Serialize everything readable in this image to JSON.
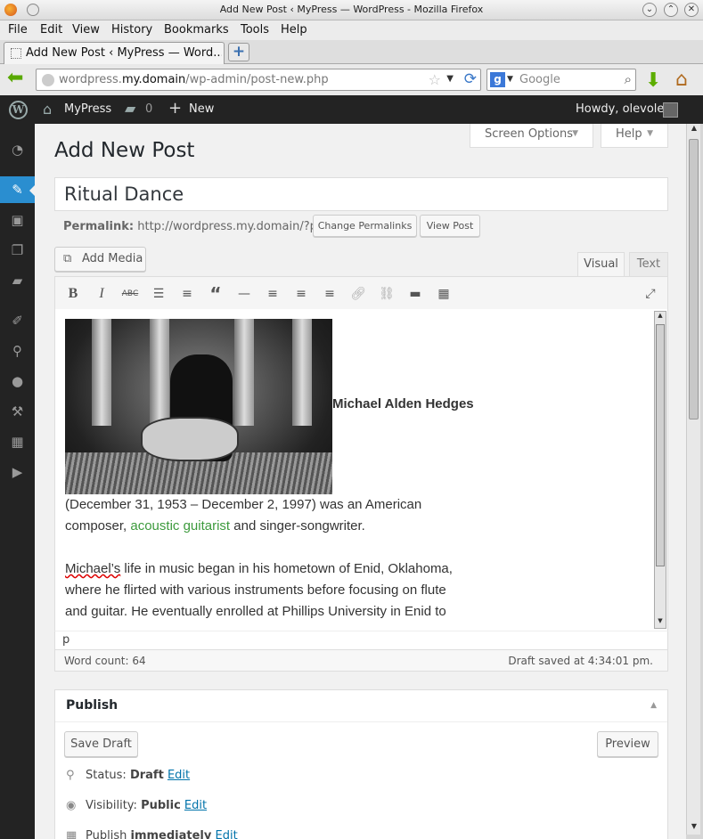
{
  "window": {
    "title": "Add New Post ‹ MyPress — WordPress - Mozilla Firefox"
  },
  "menubar": [
    "File",
    "Edit",
    "View",
    "History",
    "Bookmarks",
    "Tools",
    "Help"
  ],
  "tab": {
    "label": "Add New Post ‹ MyPress — Word...",
    "new_tab": "+"
  },
  "nav": {
    "url_prefix": "wordpress.",
    "url_domain": "my.domain",
    "url_path": "/wp-admin/post-new.php",
    "search_placeholder": "Google",
    "search_engine": "g"
  },
  "adminbar": {
    "site_name": "MyPress",
    "comments_count": "0",
    "new_label": "New",
    "howdy": "Howdy, olevole",
    "wp_logo": "W"
  },
  "sidebar": {
    "items": [
      "dashboard-icon",
      "posts-icon",
      "media-icon",
      "pages-icon",
      "comments-icon",
      "appearance-icon",
      "plugins-icon",
      "users-icon",
      "tools-icon",
      "settings-icon",
      "collapse-icon"
    ]
  },
  "header": {
    "screen_options": "Screen Options",
    "help": "Help"
  },
  "page": {
    "title": "Add New Post",
    "post_title": "Ritual Dance",
    "permalink_label": "Permalink:",
    "permalink_url": "http://wordpress.my.domain/?p=4",
    "change_permalinks": "Change Permalinks",
    "view_post": "View Post",
    "add_media": "Add Media"
  },
  "editor": {
    "tab_visual": "Visual",
    "tab_text": "Text",
    "heading_name": "Michael Alden Hedges",
    "line1": "(December 31, 1953 – December 2, 1997) was an American",
    "line2_a": "composer, ",
    "line2_link": "acoustic guitarist",
    "line2_b": " and singer-songwriter.",
    "line3_word": "Michael’s",
    "line3_rest": " life in music began in his hometown of Enid, Oklahoma,",
    "line4": "where he flirted with various instruments before focusing on flute",
    "line5": "and guitar. He eventually enrolled at Phillips University in Enid to",
    "path": "p",
    "word_count": "Word count: 64",
    "draft_saved": "Draft saved at 4:34:01 pm."
  },
  "publish": {
    "title": "Publish",
    "save_draft": "Save Draft",
    "preview": "Preview",
    "status_label": "Status: ",
    "status_value": "Draft",
    "visibility_label": "Visibility: ",
    "visibility_value": "Public",
    "publish_label": "Publish ",
    "publish_value": "immediately",
    "edit": "Edit"
  },
  "colors": {
    "accent": "#2a8ed0",
    "adminbar": "#232323",
    "link_green": "#3c9a3c",
    "link_blue": "#0073aa"
  }
}
